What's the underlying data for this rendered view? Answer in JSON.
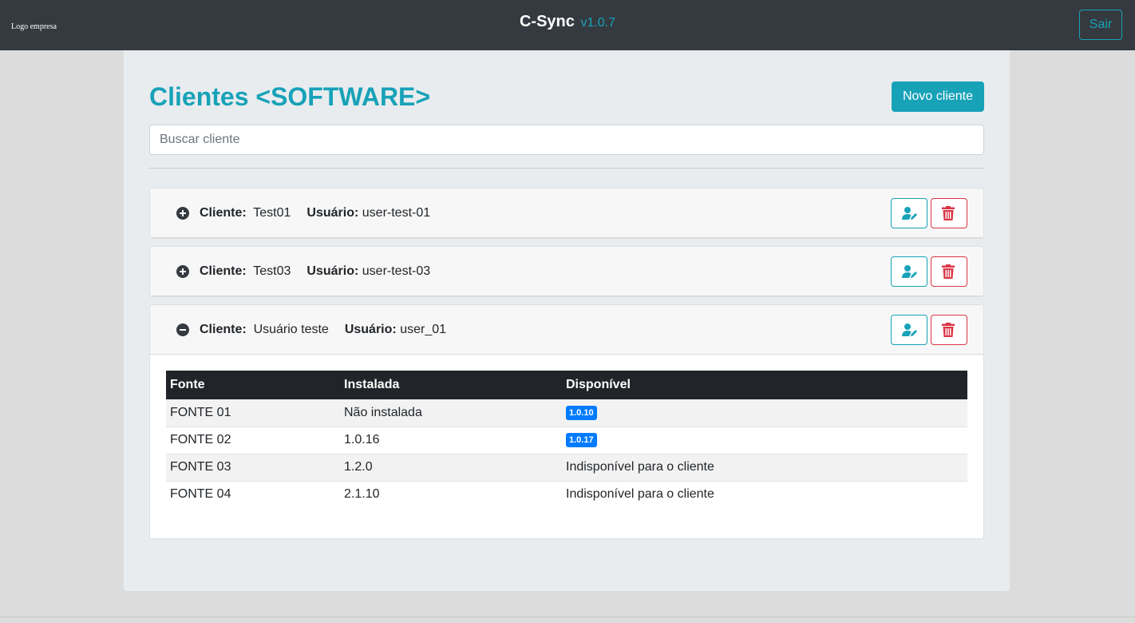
{
  "navbar": {
    "logo_text": "Logo empresa",
    "app_name": "C-Sync",
    "version": "v1.0.7",
    "logout_label": "Sair"
  },
  "page": {
    "title": "Clientes <SOFTWARE>",
    "new_client_label": "Novo cliente",
    "search_placeholder": "Buscar cliente"
  },
  "labels": {
    "client": "Cliente:",
    "user": "Usuário:"
  },
  "clients": [
    {
      "name": "Test01",
      "user": "user-test-01",
      "expanded": false
    },
    {
      "name": "Test03",
      "user": "user-test-03",
      "expanded": false
    },
    {
      "name": "Usuário teste",
      "user": "user_01",
      "expanded": true
    }
  ],
  "table": {
    "headers": [
      "Fonte",
      "Instalada",
      "Disponível"
    ],
    "rows": [
      {
        "fonte": "FONTE 01",
        "instalada": "Não instalada",
        "disponivel": "1.0.10",
        "disponivel_badge": true
      },
      {
        "fonte": "FONTE 02",
        "instalada": "1.0.16",
        "disponivel": "1.0.17",
        "disponivel_badge": true
      },
      {
        "fonte": "FONTE 03",
        "instalada": "1.2.0",
        "disponivel": "Indisponível para o cliente",
        "disponivel_badge": false
      },
      {
        "fonte": "FONTE 04",
        "instalada": "2.1.10",
        "disponivel": "Indisponível para o cliente",
        "disponivel_badge": false
      }
    ]
  },
  "icons": {
    "expand": "plus-circle-icon",
    "collapse": "minus-circle-icon",
    "edit": "user-edit-icon",
    "delete": "trash-icon"
  },
  "colors": {
    "navbar": "#343a40",
    "accent": "#17a2b8",
    "danger": "#dc3545",
    "badge": "#007bff",
    "table_header": "#212529"
  }
}
